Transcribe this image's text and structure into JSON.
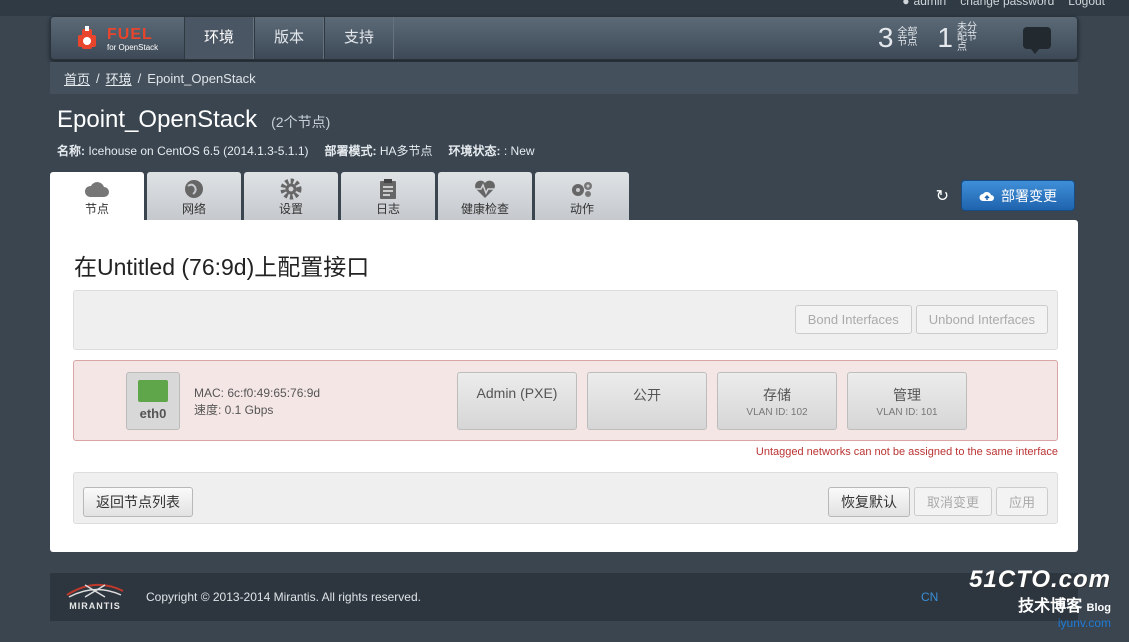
{
  "top": {
    "user": "admin",
    "change_password": "change password",
    "logout": "Logout"
  },
  "nav": {
    "logo_main": "FUEL",
    "logo_sub": "for OpenStack",
    "tabs": [
      {
        "label": "环境",
        "active": true
      },
      {
        "label": "版本",
        "active": false
      },
      {
        "label": "支持",
        "active": false
      }
    ],
    "counters": [
      {
        "number": "3",
        "label": "全部节点"
      },
      {
        "number": "1",
        "label": "未分配节点"
      }
    ]
  },
  "breadcrumb": {
    "home": "首页",
    "envs": "环境",
    "current": "Epoint_OpenStack",
    "sep": "/"
  },
  "env": {
    "name": "Epoint_OpenStack",
    "node_count": "(2个节点)",
    "name_label": "名称:",
    "name_value": "Icehouse on CentOS 6.5 (2014.1.3-5.1.1)",
    "mode_label": "部署模式:",
    "mode_value": "HA多节点",
    "status_label": "环境状态:",
    "status_value": ": New"
  },
  "subtabs": [
    {
      "label": "节点",
      "icon": "cloud-icon",
      "active": true
    },
    {
      "label": "网络",
      "icon": "globe-icon",
      "active": false
    },
    {
      "label": "设置",
      "icon": "gear-icon",
      "active": false
    },
    {
      "label": "日志",
      "icon": "clipboard-icon",
      "active": false
    },
    {
      "label": "健康检查",
      "icon": "heart-pulse-icon",
      "active": false
    },
    {
      "label": "动作",
      "icon": "cogs-icon",
      "active": false
    }
  ],
  "deploy": {
    "label": "部署变更"
  },
  "panel": {
    "title": "在Untitled (76:9d)上配置接口",
    "bond_label": "Bond Interfaces",
    "unbond_label": "Unbond Interfaces",
    "iface": {
      "name": "eth0",
      "mac": "MAC: 6c:f0:49:65:76:9d",
      "speed": "速度: 0.1 Gbps"
    },
    "networks": [
      {
        "name": "Admin (PXE)",
        "vlan": ""
      },
      {
        "name": "公开",
        "vlan": ""
      },
      {
        "name": "存储",
        "vlan": "VLAN ID: 102"
      },
      {
        "name": "管理",
        "vlan": "VLAN ID: 101"
      }
    ],
    "warning": "Untagged networks can not be assigned to the same interface",
    "back_label": "返回节点列表",
    "reset_label": "恢复默认",
    "cancel_label": "取消变更",
    "apply_label": "应用"
  },
  "footer": {
    "brand": "MIRANTIS",
    "copyright": "Copyright © 2013-2014 Mirantis. All rights reserved.",
    "lang": "CN"
  },
  "watermark": {
    "main": "51CTO.com",
    "sub": "技术博客",
    "blog": "Blog",
    "site": "iyunv.com"
  }
}
